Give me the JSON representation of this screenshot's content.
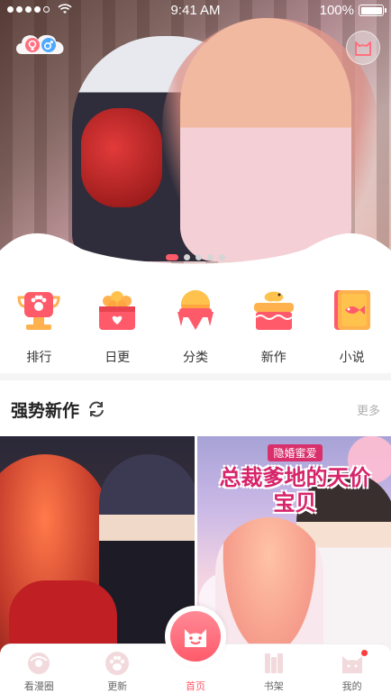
{
  "status_bar": {
    "time": "9:41 AM",
    "battery": "100%"
  },
  "hero": {
    "pager_total": 5,
    "pager_active": 0
  },
  "categories": [
    {
      "label": "排行",
      "icon": "trophy-icon"
    },
    {
      "label": "日更",
      "icon": "daily-basket-icon"
    },
    {
      "label": "分类",
      "icon": "category-ribbon-icon"
    },
    {
      "label": "新作",
      "icon": "new-cake-icon"
    },
    {
      "label": "小说",
      "icon": "novel-book-icon"
    }
  ],
  "section": {
    "title": "强势新作",
    "more": "更多"
  },
  "cards": [
    {
      "tag": "",
      "title": ""
    },
    {
      "tag": "隐婚蜜爱",
      "title": "总裁爹地的天价宝贝"
    }
  ],
  "tabbar": {
    "tabs": [
      {
        "label": "看漫圈",
        "icon": "donut-icon"
      },
      {
        "label": "更新",
        "icon": "paw-icon"
      },
      {
        "label": "首页",
        "icon": "home-cat-icon"
      },
      {
        "label": "书架",
        "icon": "bookshelf-icon"
      },
      {
        "label": "我的",
        "icon": "cat-profile-icon"
      }
    ],
    "active_index": 2
  },
  "colors": {
    "accent": "#ff5a6a",
    "muted_text": "#b0b0b0"
  }
}
